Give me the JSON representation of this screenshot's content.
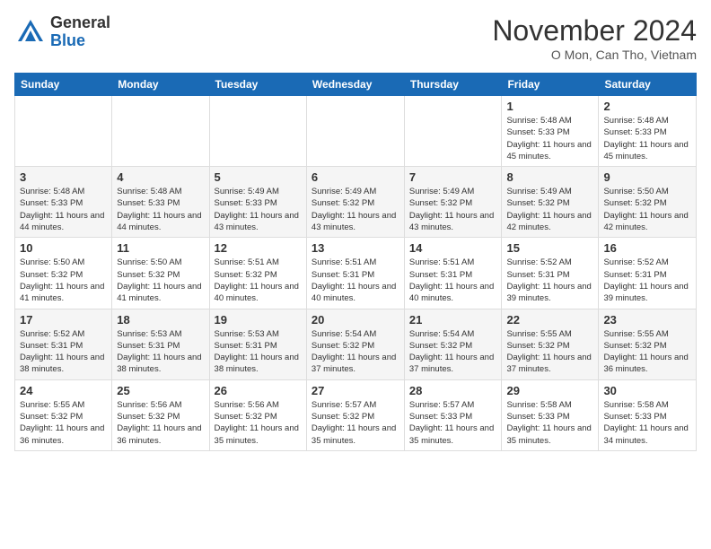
{
  "logo": {
    "general": "General",
    "blue": "Blue"
  },
  "header": {
    "month": "November 2024",
    "location": "O Mon, Can Tho, Vietnam"
  },
  "weekdays": [
    "Sunday",
    "Monday",
    "Tuesday",
    "Wednesday",
    "Thursday",
    "Friday",
    "Saturday"
  ],
  "weeks": [
    [
      {
        "day": "",
        "info": ""
      },
      {
        "day": "",
        "info": ""
      },
      {
        "day": "",
        "info": ""
      },
      {
        "day": "",
        "info": ""
      },
      {
        "day": "",
        "info": ""
      },
      {
        "day": "1",
        "info": "Sunrise: 5:48 AM\nSunset: 5:33 PM\nDaylight: 11 hours and 45 minutes."
      },
      {
        "day": "2",
        "info": "Sunrise: 5:48 AM\nSunset: 5:33 PM\nDaylight: 11 hours and 45 minutes."
      }
    ],
    [
      {
        "day": "3",
        "info": "Sunrise: 5:48 AM\nSunset: 5:33 PM\nDaylight: 11 hours and 44 minutes."
      },
      {
        "day": "4",
        "info": "Sunrise: 5:48 AM\nSunset: 5:33 PM\nDaylight: 11 hours and 44 minutes."
      },
      {
        "day": "5",
        "info": "Sunrise: 5:49 AM\nSunset: 5:33 PM\nDaylight: 11 hours and 43 minutes."
      },
      {
        "day": "6",
        "info": "Sunrise: 5:49 AM\nSunset: 5:32 PM\nDaylight: 11 hours and 43 minutes."
      },
      {
        "day": "7",
        "info": "Sunrise: 5:49 AM\nSunset: 5:32 PM\nDaylight: 11 hours and 43 minutes."
      },
      {
        "day": "8",
        "info": "Sunrise: 5:49 AM\nSunset: 5:32 PM\nDaylight: 11 hours and 42 minutes."
      },
      {
        "day": "9",
        "info": "Sunrise: 5:50 AM\nSunset: 5:32 PM\nDaylight: 11 hours and 42 minutes."
      }
    ],
    [
      {
        "day": "10",
        "info": "Sunrise: 5:50 AM\nSunset: 5:32 PM\nDaylight: 11 hours and 41 minutes."
      },
      {
        "day": "11",
        "info": "Sunrise: 5:50 AM\nSunset: 5:32 PM\nDaylight: 11 hours and 41 minutes."
      },
      {
        "day": "12",
        "info": "Sunrise: 5:51 AM\nSunset: 5:32 PM\nDaylight: 11 hours and 40 minutes."
      },
      {
        "day": "13",
        "info": "Sunrise: 5:51 AM\nSunset: 5:31 PM\nDaylight: 11 hours and 40 minutes."
      },
      {
        "day": "14",
        "info": "Sunrise: 5:51 AM\nSunset: 5:31 PM\nDaylight: 11 hours and 40 minutes."
      },
      {
        "day": "15",
        "info": "Sunrise: 5:52 AM\nSunset: 5:31 PM\nDaylight: 11 hours and 39 minutes."
      },
      {
        "day": "16",
        "info": "Sunrise: 5:52 AM\nSunset: 5:31 PM\nDaylight: 11 hours and 39 minutes."
      }
    ],
    [
      {
        "day": "17",
        "info": "Sunrise: 5:52 AM\nSunset: 5:31 PM\nDaylight: 11 hours and 38 minutes."
      },
      {
        "day": "18",
        "info": "Sunrise: 5:53 AM\nSunset: 5:31 PM\nDaylight: 11 hours and 38 minutes."
      },
      {
        "day": "19",
        "info": "Sunrise: 5:53 AM\nSunset: 5:31 PM\nDaylight: 11 hours and 38 minutes."
      },
      {
        "day": "20",
        "info": "Sunrise: 5:54 AM\nSunset: 5:32 PM\nDaylight: 11 hours and 37 minutes."
      },
      {
        "day": "21",
        "info": "Sunrise: 5:54 AM\nSunset: 5:32 PM\nDaylight: 11 hours and 37 minutes."
      },
      {
        "day": "22",
        "info": "Sunrise: 5:55 AM\nSunset: 5:32 PM\nDaylight: 11 hours and 37 minutes."
      },
      {
        "day": "23",
        "info": "Sunrise: 5:55 AM\nSunset: 5:32 PM\nDaylight: 11 hours and 36 minutes."
      }
    ],
    [
      {
        "day": "24",
        "info": "Sunrise: 5:55 AM\nSunset: 5:32 PM\nDaylight: 11 hours and 36 minutes."
      },
      {
        "day": "25",
        "info": "Sunrise: 5:56 AM\nSunset: 5:32 PM\nDaylight: 11 hours and 36 minutes."
      },
      {
        "day": "26",
        "info": "Sunrise: 5:56 AM\nSunset: 5:32 PM\nDaylight: 11 hours and 35 minutes."
      },
      {
        "day": "27",
        "info": "Sunrise: 5:57 AM\nSunset: 5:32 PM\nDaylight: 11 hours and 35 minutes."
      },
      {
        "day": "28",
        "info": "Sunrise: 5:57 AM\nSunset: 5:33 PM\nDaylight: 11 hours and 35 minutes."
      },
      {
        "day": "29",
        "info": "Sunrise: 5:58 AM\nSunset: 5:33 PM\nDaylight: 11 hours and 35 minutes."
      },
      {
        "day": "30",
        "info": "Sunrise: 5:58 AM\nSunset: 5:33 PM\nDaylight: 11 hours and 34 minutes."
      }
    ]
  ]
}
